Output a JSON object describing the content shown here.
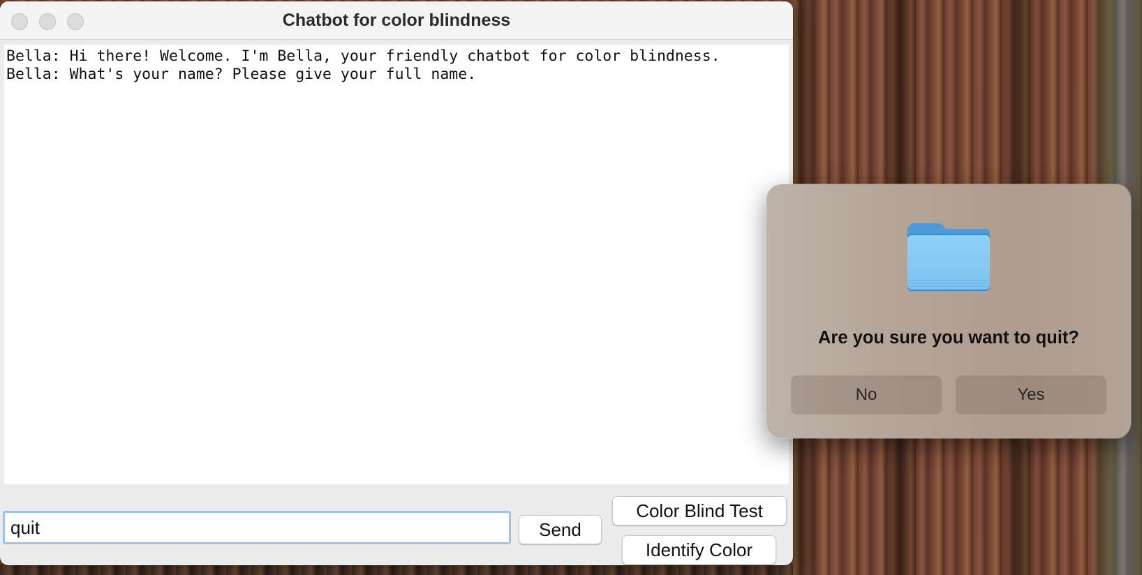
{
  "window": {
    "title": "Chatbot for color blindness"
  },
  "chat": {
    "messages": [
      "Bella: Hi there! Welcome. I'm Bella, your friendly chatbot for color blindness.",
      "Bella: What's your name? Please give your full name."
    ]
  },
  "input": {
    "value": "quit"
  },
  "buttons": {
    "send": "Send",
    "color_blind_test": "Color Blind Test",
    "identify_color": "Identify Color"
  },
  "dialog": {
    "icon": "folder-icon",
    "message": "Are you sure you want to quit?",
    "no_label": "No",
    "yes_label": "Yes"
  },
  "colors": {
    "input_focus_ring": "#9cc1ef",
    "folder_blue": "#7ec5f3"
  }
}
